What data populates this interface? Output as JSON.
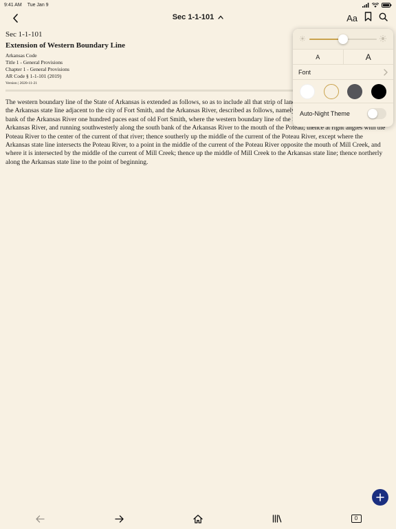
{
  "status_bar": {
    "time": "9:41 AM",
    "date": "Tue Jan 9"
  },
  "nav": {
    "title": "Sec 1-1-101",
    "aa_label": "Aa"
  },
  "document": {
    "section_number": "Sec 1-1-101",
    "section_title": "Extension of Western Boundary Line",
    "code_name": "Arkansas Code",
    "title_line": "Title 1 - General Provisions",
    "chapter_line": "Chapter 1 - General Provisions",
    "citation": "AR Code § 1-1-101 (2019)",
    "version": "Version | 2020-11-21",
    "body": "The western boundary line of the State of Arkansas is extended as follows, so as to include all that strip of land lying and being situated between the Arkansas state line adjacent to the city of Fort Smith, and the Arkansas River, described as follows, namely: Beginning at a point on the south bank of the Arkansas River one hundred paces east of old Fort Smith, where the western boundary line of the State of Arkansas crosses the Arkansas River, and running southwesterly along the south bank of the Arkansas River to the mouth of the Poteau; thence at right angles with the Poteau River to the center of the current of that river; thence southerly up the middle of the current of the Poteau River, except where the Arkansas state line intersects the Poteau River, to a point in the middle of the current of the Poteau River opposite the mouth of Mill Creek, and where it is intersected by the middle of the current of Mill Creek; thence up the middle of Mill Creek to the Arkansas state line; thence northerly along the Arkansas state line to the point of beginning."
  },
  "display_settings": {
    "brightness": 0.5,
    "font_size_small_label": "A",
    "font_size_large_label": "A",
    "font_label": "Font",
    "themes": [
      {
        "name": "white",
        "color": "#ffffff",
        "selected": false
      },
      {
        "name": "sepia",
        "color": "#f8f1e3",
        "selected": true
      },
      {
        "name": "gray",
        "color": "#55555a",
        "selected": false
      },
      {
        "name": "night",
        "color": "#000000",
        "selected": false
      }
    ],
    "auto_night_label": "Auto-Night Theme",
    "auto_night_enabled": false
  },
  "toolbar": {
    "tab_count": "0"
  },
  "colors": {
    "background": "#f8f1e3",
    "accent": "#1b2f80",
    "slider": "#c9a24c"
  },
  "icons": [
    "back-chevron-icon",
    "chevron-up-icon",
    "bookmark-icon",
    "search-icon",
    "sun-small-icon",
    "sun-large-icon",
    "chevron-right-icon",
    "plus-icon",
    "back-arrow-icon",
    "forward-arrow-icon",
    "home-icon",
    "library-icon",
    "tabs-icon"
  ]
}
